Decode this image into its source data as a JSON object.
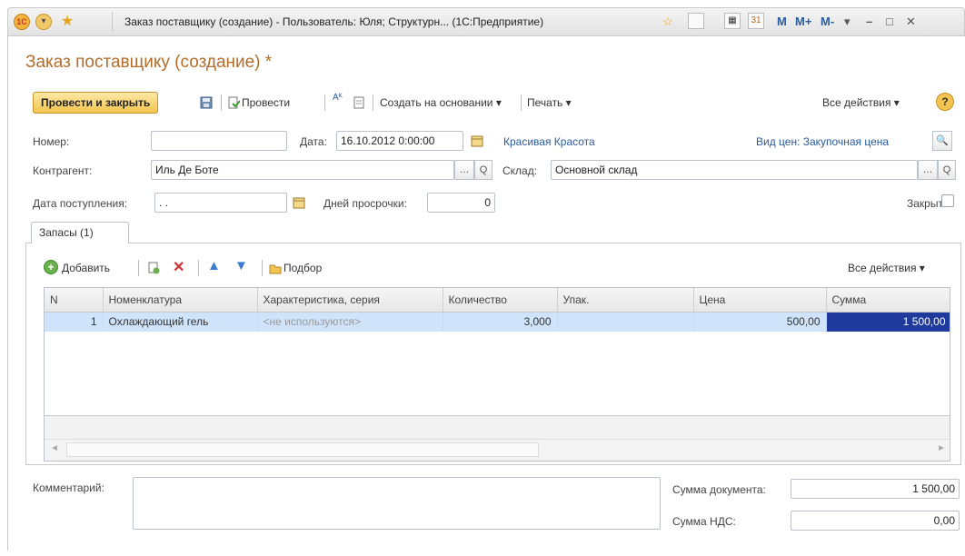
{
  "titlebar": {
    "logo_text": "1C",
    "title": "Заказ поставщику (создание) - Пользователь: Юля;  Структурн...  (1С:Предприятие)",
    "m": "M",
    "mplus": "M+",
    "mminus": "M-"
  },
  "form": {
    "title": "Заказ поставщику (создание) *"
  },
  "toolbar": {
    "post_close": "Провести и закрыть",
    "post": "Провести",
    "create_based": "Создать на основании ▾",
    "print": "Печать ▾",
    "all_actions": "Все действия ▾",
    "help": "?"
  },
  "fields": {
    "number_label": "Номер:",
    "number_value": "",
    "date_label": "Дата:",
    "date_value": "16.10.2012  0:00:00",
    "org_link": "Красивая Красота",
    "price_type_link": "Вид цен: Закупочная цена",
    "contractor_label": "Контрагент:",
    "contractor_value": "Иль Де Боте",
    "warehouse_label": "Склад:",
    "warehouse_value": "Основной склад",
    "receipt_date_label": "Дата поступления:",
    "receipt_date_value": " .  .",
    "overdue_label": "Дней просрочки:",
    "overdue_value": "0",
    "closed_label": "Закрыт:"
  },
  "tabs": [
    {
      "label": "Запасы (1)"
    }
  ],
  "table_toolbar": {
    "add": "Добавить",
    "pick": "Подбор",
    "all_actions": "Все действия ▾"
  },
  "table": {
    "columns": [
      "N",
      "Номенклатура",
      "Характеристика, серия",
      "Количество",
      "Упак.",
      "Цена",
      "Сумма"
    ],
    "rows": [
      [
        "1",
        "Охлаждающий гель",
        "<не используются>",
        "3,000",
        "",
        "500,00",
        "1 500,00"
      ]
    ]
  },
  "footer": {
    "comment_label": "Комментарий:",
    "doc_sum_label": "Сумма документа:",
    "doc_sum_value": "1 500,00",
    "vat_label": "Сумма НДС:",
    "vat_value": "0,00"
  },
  "colors": {
    "title": "#b46c2a",
    "link": "#2a5b9e",
    "selection": "#cfe3fa",
    "focus_cell": "#1f3a9c"
  }
}
